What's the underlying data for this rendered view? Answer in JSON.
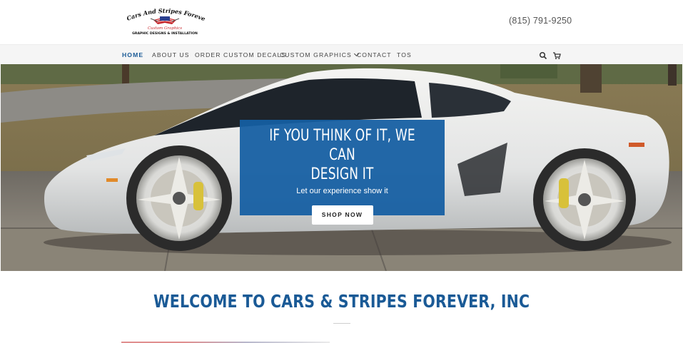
{
  "header": {
    "logo": {
      "line1": "Cars And Stripes Forever Inc.",
      "line2": "Custom Graphics",
      "line3": "GRAPHIC DESIGNS & INSTALLATION"
    },
    "phone": "(815) 791-9250"
  },
  "nav": {
    "items": [
      {
        "label": "HOME",
        "active": true
      },
      {
        "label": "ABOUT US"
      },
      {
        "label": "ORDER CUSTOM DECALS"
      },
      {
        "label": "CUSTOM GRAPHICS"
      },
      {
        "label": "CONTACT"
      },
      {
        "label": "TOS"
      }
    ],
    "icons": [
      "search-icon",
      "cart-icon"
    ]
  },
  "hero": {
    "title_line1": "IF YOU THINK OF IT, WE CAN",
    "title_line2": "DESIGN IT",
    "subtitle": "Let our experience show it",
    "button": "SHOP NOW"
  },
  "welcome": {
    "title": "WELCOME TO CARS & STRIPES FOREVER, INC"
  },
  "colors": {
    "brand_blue": "#1a5a96",
    "hero_box": "#155fa3",
    "nav_bg": "#f5f5f5"
  }
}
